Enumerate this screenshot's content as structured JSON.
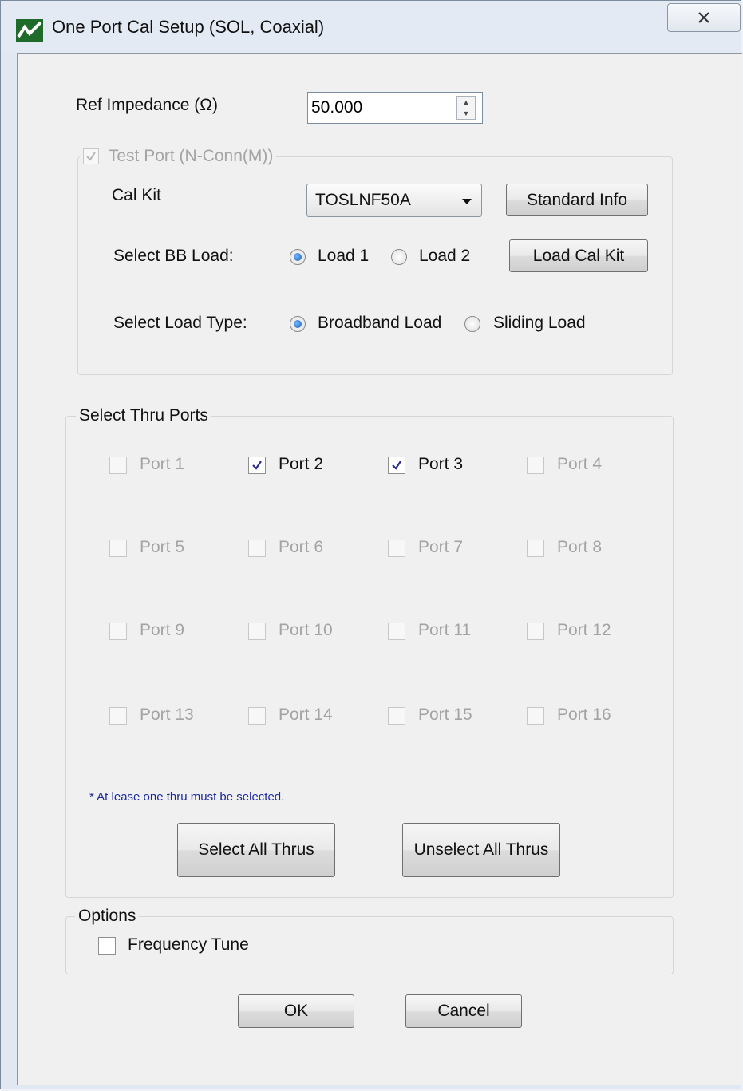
{
  "window": {
    "title": "One Port Cal Setup (SOL, Coaxial)",
    "close_glyph": "✕"
  },
  "ref_impedance": {
    "label": "Ref Impedance (Ω)",
    "value": "50.000"
  },
  "test_port": {
    "label": "Test Port (N-Conn(M))",
    "checked": true,
    "enabled": false,
    "cal_kit_label": "Cal Kit",
    "cal_kit_value": "TOSLNF50A",
    "standard_info_label": "Standard Info",
    "bb_load_label": "Select BB Load:",
    "load1_label": "Load 1",
    "load2_label": "Load 2",
    "bb_load_selected": "Load 1",
    "load_cal_kit_label": "Load Cal Kit",
    "load_type_label": "Select Load Type:",
    "broadband_label": "Broadband Load",
    "sliding_label": "Sliding Load",
    "load_type_selected": "Broadband Load"
  },
  "thru_ports": {
    "group_label": "Select Thru Ports",
    "ports": [
      {
        "label": "Port 1",
        "checked": false,
        "enabled": false
      },
      {
        "label": "Port 2",
        "checked": true,
        "enabled": true
      },
      {
        "label": "Port 3",
        "checked": true,
        "enabled": true
      },
      {
        "label": "Port 4",
        "checked": false,
        "enabled": false
      },
      {
        "label": "Port 5",
        "checked": false,
        "enabled": false
      },
      {
        "label": "Port 6",
        "checked": false,
        "enabled": false
      },
      {
        "label": "Port 7",
        "checked": false,
        "enabled": false
      },
      {
        "label": "Port 8",
        "checked": false,
        "enabled": false
      },
      {
        "label": "Port 9",
        "checked": false,
        "enabled": false
      },
      {
        "label": "Port 10",
        "checked": false,
        "enabled": false
      },
      {
        "label": "Port 11",
        "checked": false,
        "enabled": false
      },
      {
        "label": "Port 12",
        "checked": false,
        "enabled": false
      },
      {
        "label": "Port 13",
        "checked": false,
        "enabled": false
      },
      {
        "label": "Port 14",
        "checked": false,
        "enabled": false
      },
      {
        "label": "Port 15",
        "checked": false,
        "enabled": false
      },
      {
        "label": "Port 16",
        "checked": false,
        "enabled": false
      }
    ],
    "note": "* At lease one thru must be selected.",
    "select_all_label": "Select All Thrus",
    "unselect_all_label": "Unselect All Thrus"
  },
  "options": {
    "group_label": "Options",
    "frequency_tune_label": "Frequency Tune",
    "frequency_tune_checked": false
  },
  "footer": {
    "ok_label": "OK",
    "cancel_label": "Cancel"
  }
}
